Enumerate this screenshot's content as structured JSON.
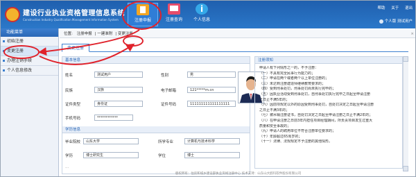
{
  "header": {
    "title": "建设行业执业资格管理信息系统",
    "subtitle": "Construction Industry Qualification Management Information System",
    "nav": [
      {
        "label": "注册申报"
      },
      {
        "label": "注册查询"
      },
      {
        "label": "个人信息"
      }
    ],
    "links": {
      "help": "帮助",
      "about": "关于",
      "exit": "退出"
    },
    "user": {
      "greeting": "个人版",
      "name": "测试用户"
    }
  },
  "sidebar": {
    "title": "功能菜单",
    "items": [
      {
        "label": "初始注册"
      },
      {
        "label": "变更注册"
      },
      {
        "label": "办理注销手续"
      },
      {
        "label": "个人信息修改"
      }
    ]
  },
  "breadcrumb": {
    "label": "位置:",
    "items": [
      "注册申报",
      "一建准附",
      "变更注册"
    ],
    "close": "×"
  },
  "tab": {
    "label": "变更注册"
  },
  "form": {
    "basic_section": "基本信息",
    "name_label": "姓名",
    "name_value": "测试用户",
    "gender_label": "性别",
    "gender_value": "男",
    "ethnicity_label": "民族",
    "ethnicity_value": "汉族",
    "email_label": "电子邮箱",
    "email_value": "121*****m.cn",
    "idtype_label": "证件类型",
    "idtype_value": "身份证",
    "idno_label": "证件号码",
    "idno_value": "111111111111111111",
    "phone_label": "手机号码",
    "phone_value": "************",
    "edu_section": "学历信息",
    "school_label": "毕业院校",
    "school_value": "山东大学",
    "major_label": "所学专业",
    "major_value": "计算机与技术科学",
    "degree_label": "学历",
    "degree_value": "博士研究生",
    "degree2_label": "学位",
    "degree2_value": "博士",
    "dots": "..."
  },
  "notice": {
    "title": "注册须知",
    "lines": [
      "申请人有下列情形之一的，不予注册：",
      "（一）不具有完全民事行为能力的；",
      "（二）申请在两个或者两个以上单位注册的；",
      "（三）未达到注册建造师继续教育要求的；",
      "（四）受到刑事处罚，刑事处罚尚未执行完毕的；",
      "（五）因执业活动受到刑事处罚，自刑事处罚执行完毕之日起至申请注册",
      "之日止不满5年的；",
      "（六）因前项规定以外的原因受到刑事处罚，自处罚决定之日起至申请注册",
      "之日止不满3年的；",
      "（七）被吊销注册证书，自处罚决定之日起至申请注册之日止不满2年的；",
      "（八）在申请注册之日前3年内担任项目经理期间，所负责项目发生过重大",
      "质量和安全事故的；",
      "（九）申请人的聘用单位不符合注册单位要求的；",
      "（十）年龄超过65周岁的；",
      "（十一）法律、法规规定不予注册的其他情形。"
    ]
  },
  "footer": {
    "text": "版权所有：住房和城乡建设部执业资格注册中心    技术支持：山东山大鸥玛软件股份有限公司"
  },
  "colors": {
    "header": "#2b78c9",
    "annotation": "#e0222b",
    "accent": "#3c7fcf"
  }
}
